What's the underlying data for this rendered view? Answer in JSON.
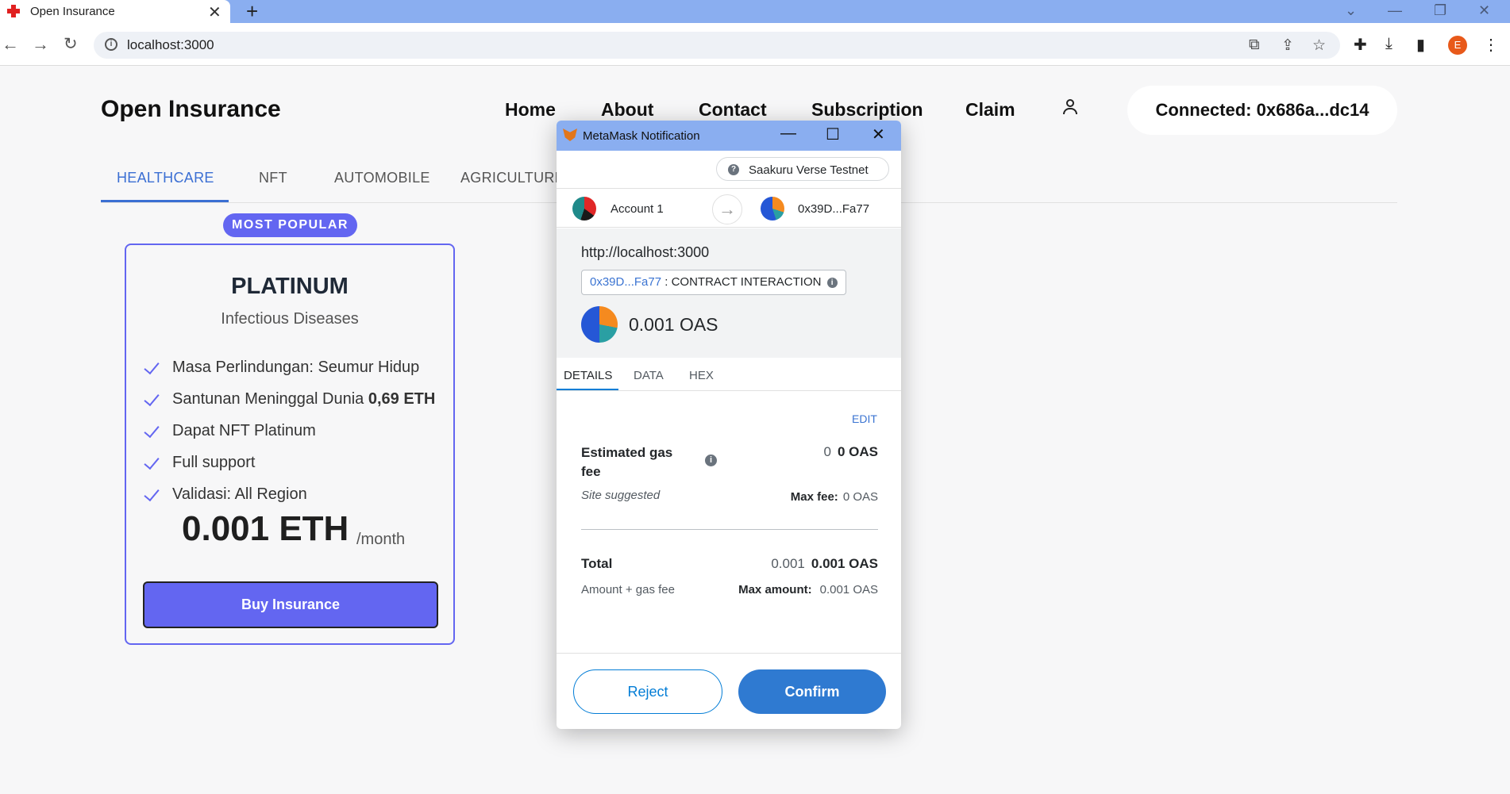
{
  "browser": {
    "tab_title": "Open Insurance",
    "tab_close": "✕",
    "new_tab": "+",
    "url": "localhost:3000",
    "window_controls": [
      "⌄",
      "—",
      "❐",
      "✕"
    ],
    "profile_initial": "E"
  },
  "page": {
    "brand": "Open Insurance",
    "nav": [
      "Home",
      "About",
      "Contact",
      "Subscription",
      "Claim"
    ],
    "connected": "Connected: 0x686a...dc14",
    "categories": [
      "HEALTHCARE",
      "NFT",
      "AUTOMOBILE",
      "AGRICULTURE"
    ],
    "active_category": "HEALTHCARE",
    "accent_color": "#6366f1",
    "card": {
      "badge": "MOST POPULAR",
      "title": "PLATINUM",
      "subtitle": "Infectious Diseases",
      "features": [
        {
          "text": "Masa Perlindungan: Seumur Hidup",
          "bold": ""
        },
        {
          "text": "Santunan Meninggal Dunia ",
          "bold": "0,69 ETH"
        },
        {
          "text": "Dapat NFT Platinum",
          "bold": ""
        },
        {
          "text": "Full support",
          "bold": ""
        },
        {
          "text": "Validasi: All Region",
          "bold": ""
        }
      ],
      "price": "0.001 ETH",
      "price_unit": "/month",
      "button": "Buy Insurance"
    }
  },
  "metamask": {
    "window_title": "MetaMask Notification",
    "network": "Saakuru Verse Testnet",
    "from_account": "Account 1",
    "to_address": "0x39D...Fa77",
    "origin": "http://localhost:3000",
    "method_address": "0x39D...Fa77",
    "method_label": ": CONTRACT INTERACTION",
    "amount": "0.001 OAS",
    "tabs": [
      "DETAILS",
      "DATA",
      "HEX"
    ],
    "active_tab": "DETAILS",
    "edit": "EDIT",
    "gas_label": "Estimated gas fee",
    "gas_value_plain": "0",
    "gas_value_bold": "0 OAS",
    "site_suggested": "Site suggested",
    "max_fee_label": "Max fee:",
    "max_fee_value": "0 OAS",
    "total_label": "Total",
    "total_plain": "0.001",
    "total_bold": "0.001 OAS",
    "amount_gas_fee": "Amount + gas fee",
    "max_amount_label": "Max amount:",
    "max_amount_value": "0.001 OAS",
    "reject": "Reject",
    "confirm": "Confirm"
  }
}
